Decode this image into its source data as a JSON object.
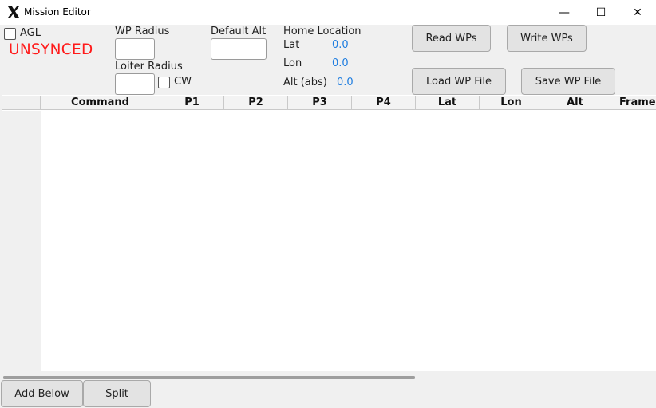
{
  "window": {
    "title": "Mission Editor"
  },
  "titlebar": {
    "minimize": "—",
    "maximize": "☐",
    "close": "✕"
  },
  "controls": {
    "agl_label": "AGL",
    "status": "UNSYNCED",
    "wp_radius_label": "WP Radius",
    "loiter_radius_label": "Loiter Radius",
    "cw_label": "CW",
    "default_alt_label": "Default Alt",
    "home_location_label": "Home Location",
    "lat_label": "Lat",
    "lon_label": "Lon",
    "alt_label": "Alt (abs)",
    "lat_value": "0.0",
    "lon_value": "0.0",
    "alt_value": "0.0"
  },
  "buttons": {
    "read_wps": "Read WPs",
    "write_wps": "Write WPs",
    "load_wp_file": "Load WP File",
    "save_wp_file": "Save WP File",
    "add_below": "Add Below",
    "split": "Split"
  },
  "table": {
    "columns": [
      "Command",
      "P1",
      "P2",
      "P3",
      "P4",
      "Lat",
      "Lon",
      "Alt",
      "Frame"
    ]
  },
  "colors": {
    "status": "#ff1a1a",
    "value": "#1e7de0"
  }
}
